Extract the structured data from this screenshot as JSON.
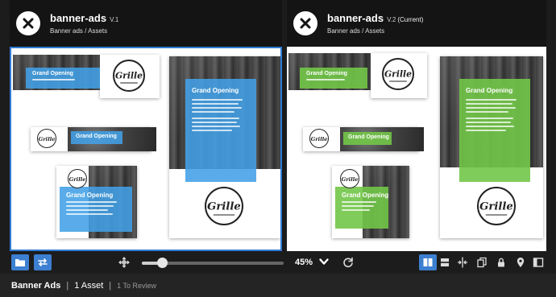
{
  "left_pane": {
    "title": "banner-ads",
    "version": "V.1",
    "breadcrumb": "Banner ads / Assets",
    "accent": "#42a0e6"
  },
  "right_pane": {
    "title": "banner-ads",
    "version": "V.2",
    "current_label": "(Current)",
    "breadcrumb": "Banner ads / Assets",
    "accent": "#72c648"
  },
  "banner": {
    "headline": "Grand Opening",
    "logo_text": "Grille"
  },
  "toolbar": {
    "zoom": "45%",
    "slider_value": 0.14,
    "icons": [
      "folder-icon",
      "swap-icon",
      "pan-icon",
      "zoom-slider",
      "zoom-dropdown",
      "refresh-icon",
      "side-by-side-icon",
      "stacked-icon",
      "split-compare-icon",
      "overlay-icon",
      "lock-icon",
      "pin-icon",
      "panel-icon"
    ]
  },
  "status": {
    "project": "Banner Ads",
    "assets": "1 Asset",
    "review": "1 To Review"
  }
}
